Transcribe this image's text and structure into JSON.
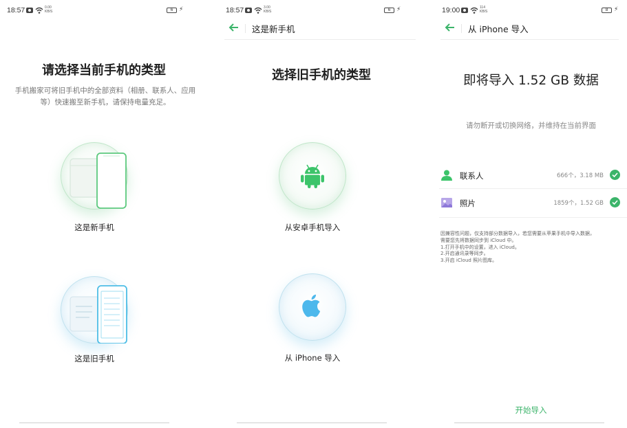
{
  "screen1": {
    "status": {
      "time": "18:57",
      "speed_value": "0.00",
      "speed_unit": "KB/S",
      "battery": "6"
    },
    "title": "请选择当前手机的类型",
    "description": "手机搬家可将旧手机中的全部资料（相册、联系人、应用等）快速搬至新手机，请保持电量充足。",
    "option_new": "这是新手机",
    "option_old": "这是旧手机"
  },
  "screen2": {
    "status": {
      "time": "18:57",
      "speed_value": "3.00",
      "speed_unit": "KB/S",
      "battery": "6"
    },
    "header_title": "这是新手机",
    "title": "选择旧手机的类型",
    "option_android": "从安卓手机导入",
    "option_iphone": "从 iPhone 导入"
  },
  "screen3": {
    "status": {
      "time": "19:00",
      "speed_value": "114",
      "speed_unit": "KB/S",
      "battery": "8"
    },
    "header_title": "从 iPhone 导入",
    "big_title": "即将导入 1.52 GB 数据",
    "hint": "请勿断开或切换网络，并维持在当前界面",
    "items": [
      {
        "label": "联系人",
        "meta": "666个，3.18 MB",
        "icon": "contact-icon",
        "checked": true
      },
      {
        "label": "照片",
        "meta": "1859个，1.52 GB",
        "icon": "photo-icon",
        "checked": true
      }
    ],
    "note_lines": [
      "因兼容性问题，仅支持部分数据导入，若您需要从苹果手机中导入数据，",
      "需要您先将数据同步到 iCloud 中。",
      "1.打开手机中的设置，进入 iCloud。",
      "2.开启通讯录等同步。",
      "3.开启 iCloud 照片图库。"
    ],
    "start_button": "开始导入"
  },
  "colors": {
    "accent_green": "#3bb46a",
    "android_green": "#3cc46a",
    "apple_blue": "#4db8ec"
  }
}
